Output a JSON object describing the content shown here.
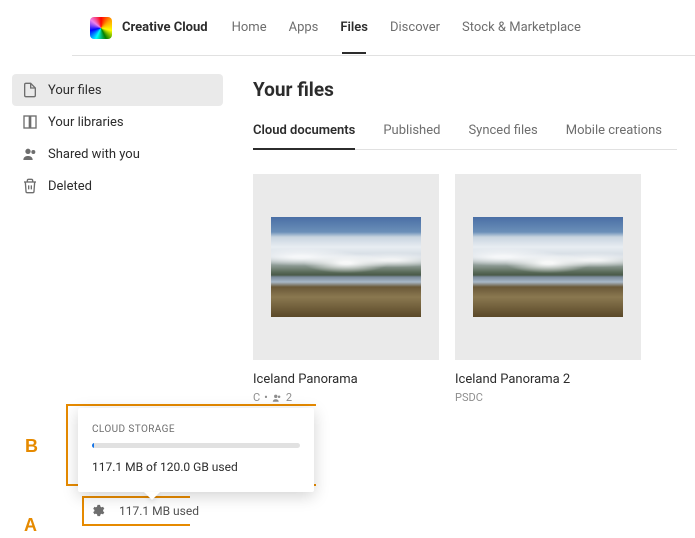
{
  "brand": "Creative Cloud",
  "topnav": {
    "items": [
      "Home",
      "Apps",
      "Files",
      "Discover",
      "Stock & Marketplace"
    ],
    "active_index": 2
  },
  "sidebar": {
    "items": [
      {
        "label": "Your files",
        "icon": "file-icon"
      },
      {
        "label": "Your libraries",
        "icon": "libraries-icon"
      },
      {
        "label": "Shared with you",
        "icon": "people-icon"
      },
      {
        "label": "Deleted",
        "icon": "trash-icon"
      }
    ],
    "active_index": 0
  },
  "page": {
    "title": "Your files",
    "tabs": [
      "Cloud documents",
      "Published",
      "Synced files",
      "Mobile creations"
    ],
    "active_tab_index": 0
  },
  "files": [
    {
      "title": "Iceland Panorama",
      "meta_text": "C",
      "shared_count": "2",
      "shared": true
    },
    {
      "title": "Iceland Panorama 2",
      "meta_text": "PSDC",
      "shared": false
    }
  ],
  "storage_popover": {
    "title": "CLOUD STORAGE",
    "used_text": "117.1 MB of 120.0 GB used",
    "percent_used": 1
  },
  "storage_strip": {
    "text": "117.1 MB used"
  },
  "callouts": {
    "a": "A",
    "b": "B"
  }
}
